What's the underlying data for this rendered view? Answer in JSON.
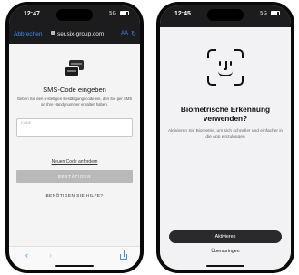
{
  "left_phone": {
    "status": {
      "time": "12:47",
      "signal": "5G"
    },
    "browser": {
      "cancel_label": "Abbrechen",
      "url": "ser.six-group.com",
      "text_size_label": "AA",
      "reload_icon": "reload-icon"
    },
    "sms": {
      "title": "SMS-Code eingeben",
      "description": "Geben Sie den 6-stelligen Bestätigungscode ein, den Sie per SMS an Ihre Handynummer erhalten haben.",
      "code_label": "CODE",
      "code_value": "",
      "new_code_link": "Neuen Code anfordern",
      "confirm_button": "BESTÄTIGEN",
      "help_link": "BENÖTIGEN SIE HILFE?"
    },
    "toolbar": {
      "back_icon": "chevron-left-icon",
      "forward_icon": "chevron-right-icon",
      "share_icon": "share-icon"
    }
  },
  "right_phone": {
    "status": {
      "time": "12:45",
      "signal": "5G"
    },
    "biometric": {
      "icon": "face-id-icon",
      "title": "Biometrische Erkennung verwenden?",
      "description": "Aktivieren Sie Biometrie, um sich schneller und einfacher in die App einzuloggen",
      "activate_button": "Aktivieren",
      "skip_link": "Überspringen"
    }
  }
}
